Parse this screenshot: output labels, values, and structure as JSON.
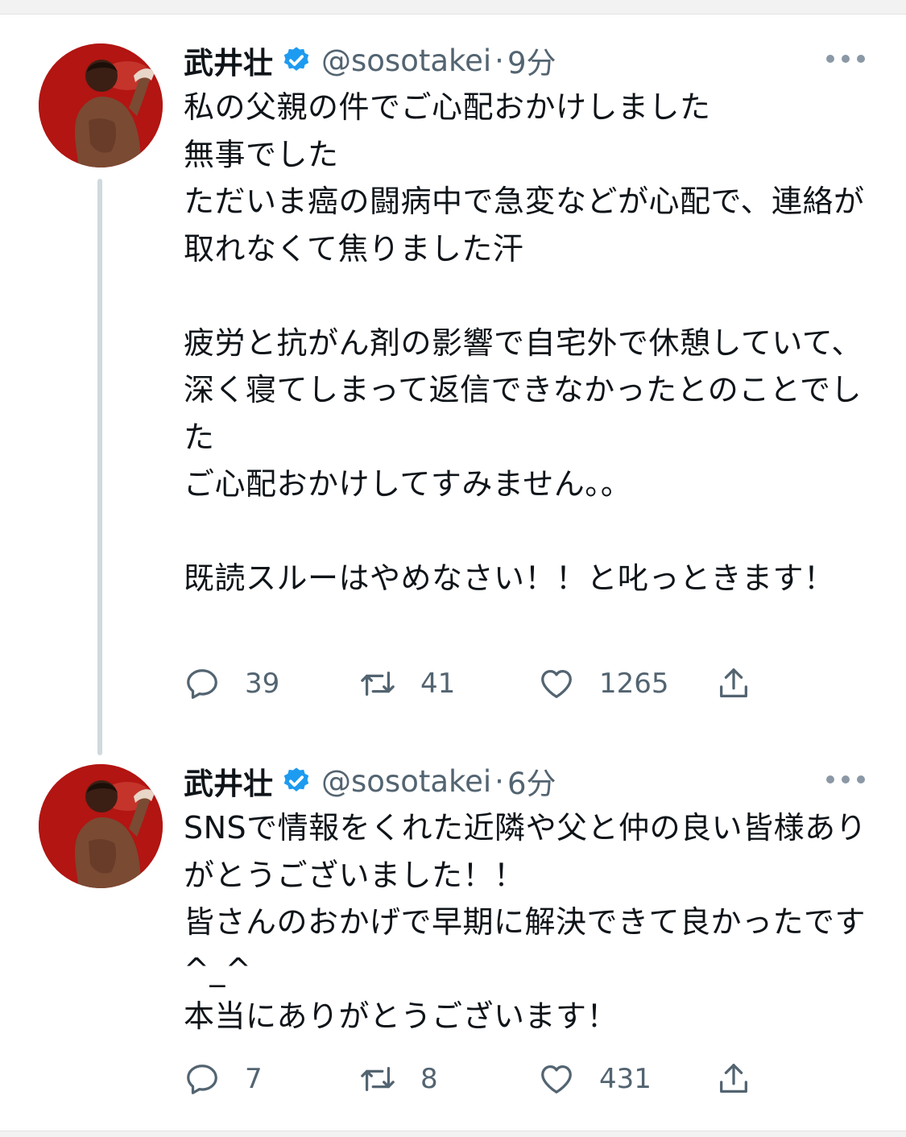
{
  "tweets": [
    {
      "display_name": "武井壮",
      "handle": "@sosotakei",
      "separator": "·",
      "time": "9分",
      "text": "私の父親の件でご心配おかけしました\n無事でした\nただいま癌の闘病中で急変などが心配で、連絡が取れなくて焦りました汗\n\n疲労と抗がん剤の影響で自宅外で休憩していて、深く寝てしまって返信できなかったとのことでした\nご心配おかけしてすみません。。\n\n既読スルーはやめなさい！！と叱っときます！",
      "reply_count": "39",
      "retweet_count": "41",
      "like_count": "1265"
    },
    {
      "display_name": "武井壮",
      "handle": "@sosotakei",
      "separator": "·",
      "time": "6分",
      "text": "SNSで情報をくれた近隣や父と仲の良い皆様ありがとうございました！！\n皆さんのおかげで早期に解決できて良かったです^_^\n本当にありがとうございます！",
      "reply_count": "7",
      "retweet_count": "8",
      "like_count": "431"
    }
  ],
  "colors": {
    "text": "#0f1419",
    "secondary": "#536471",
    "verified": "#1d9bf0",
    "avatar_bg": "#b21512",
    "thread_line": "#cfd9de"
  },
  "icons": {
    "verified": "verified-badge-icon",
    "more": "more-dots-icon",
    "reply": "reply-icon",
    "retweet": "retweet-icon",
    "like": "heart-icon",
    "share": "share-icon"
  }
}
